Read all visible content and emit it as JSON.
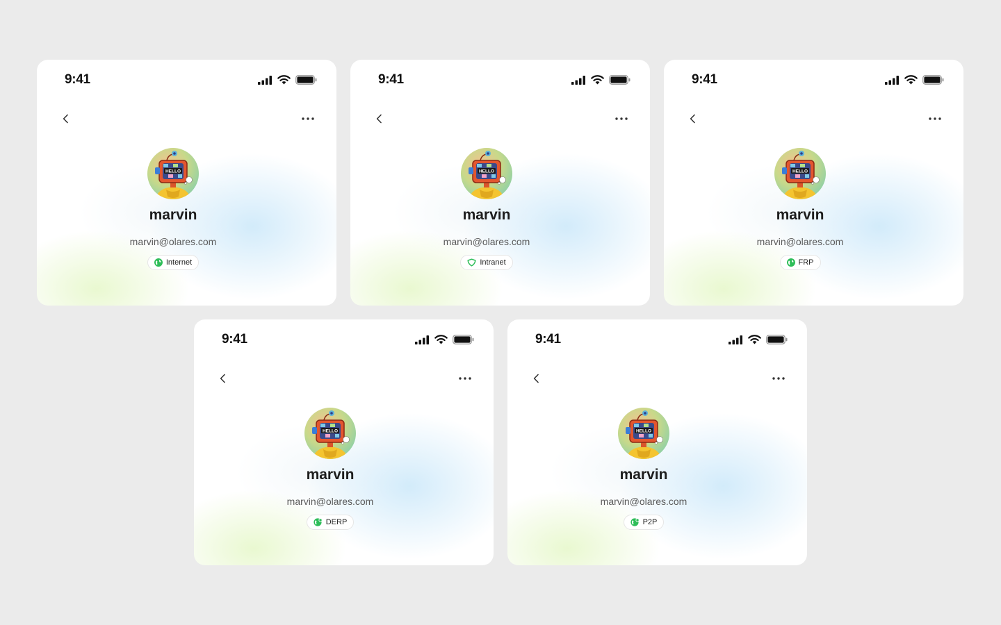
{
  "cards": [
    {
      "time": "9:41",
      "name": "marvin",
      "email": "marvin@olares.com",
      "badge": "Internet",
      "badge_icon": "globe-icon"
    },
    {
      "time": "9:41",
      "name": "marvin",
      "email": "marvin@olares.com",
      "badge": "Intranet",
      "badge_icon": "shield-icon"
    },
    {
      "time": "9:41",
      "name": "marvin",
      "email": "marvin@olares.com",
      "badge": "FRP",
      "badge_icon": "globe-icon"
    },
    {
      "time": "9:41",
      "name": "marvin",
      "email": "marvin@olares.com",
      "badge": "DERP",
      "badge_icon": "globe-link-icon"
    },
    {
      "time": "9:41",
      "name": "marvin",
      "email": "marvin@olares.com",
      "badge": "P2P",
      "badge_icon": "globe-link-icon"
    }
  ],
  "avatar_text": "HELLO",
  "colors": {
    "accent_green": "#2ebd59",
    "background": "#ebebeb"
  }
}
